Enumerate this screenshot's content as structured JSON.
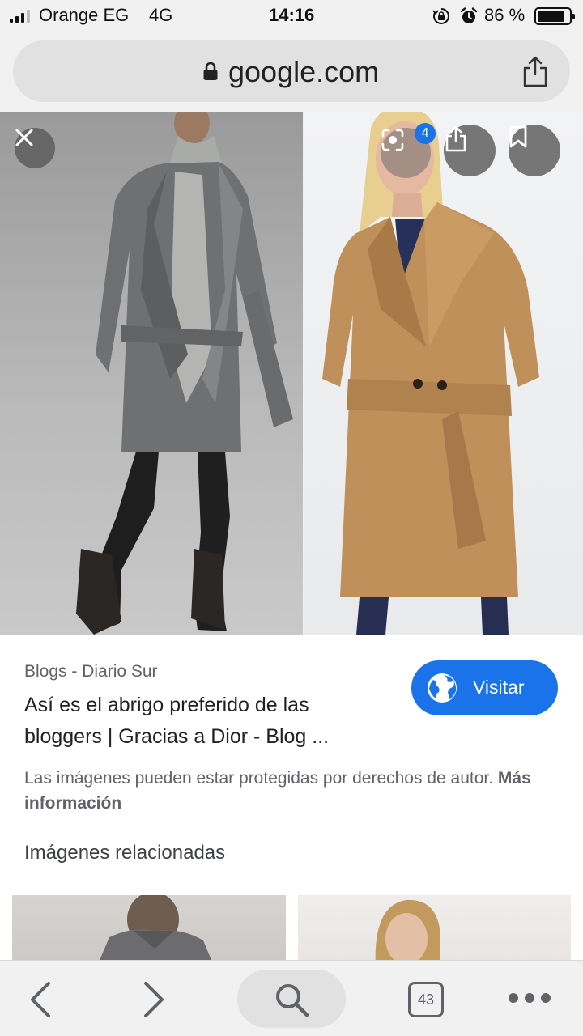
{
  "status_bar": {
    "carrier": "Orange EG",
    "network": "4G",
    "time": "14:16",
    "battery_percent": "86 %",
    "battery_level": 0.86,
    "icons": [
      "signal-icon",
      "rotation-lock-icon",
      "alarm-icon",
      "battery-icon"
    ]
  },
  "address_bar": {
    "domain": "google.com",
    "icons": [
      "lock-icon",
      "share-icon"
    ]
  },
  "image_viewer": {
    "lens_badge_count": "4",
    "icons": [
      "close-icon",
      "lens-icon",
      "share-icon",
      "bookmark-icon"
    ],
    "images": [
      "grey wrap coat",
      "camel belted coat"
    ]
  },
  "result": {
    "source": "Blogs - Diario Sur",
    "title": "Así es el abrigo preferido de las bloggers | Gracias a Dior - Blog ...",
    "visit_label": "Visitar",
    "copyright_text": "Las imágenes pueden estar protegidas por derechos de autor.",
    "more_info_label": "Más información"
  },
  "related": {
    "heading": "Imágenes relacionadas"
  },
  "toolbar": {
    "tab_count": "43",
    "icons": [
      "back-icon",
      "forward-icon",
      "search-icon",
      "tabs-icon",
      "more-icon"
    ]
  },
  "colors": {
    "accent": "#1a73e8",
    "chrome_bg": "#f1f1f1",
    "url_pill": "#e1e1e1",
    "secondary_text": "#5f6368"
  }
}
